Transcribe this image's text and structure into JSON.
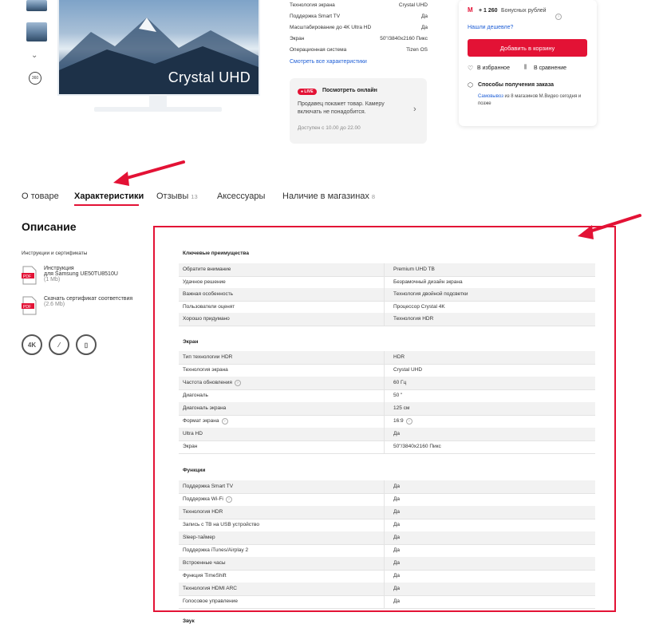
{
  "product": {
    "brand_text": "Crystal UHD"
  },
  "summary": {
    "rows": [
      {
        "label": "Технология экрана",
        "value": "Crystal UHD"
      },
      {
        "label": "Поддержка Smart TV",
        "value": "Да"
      },
      {
        "label": "Масштабирование до 4K Ultra HD",
        "value": "Да"
      },
      {
        "label": "Экран",
        "value": "50\"/3840x2160 Пикс"
      },
      {
        "label": "Операционная система",
        "value": "Tizen OS"
      }
    ],
    "all_specs_link": "Смотреть все характеристики"
  },
  "live": {
    "badge": "● LIVE",
    "title": "Посмотреть онлайн",
    "text": "Продавец покажет товар. Камеру включать не понадобится.",
    "hours": "Доступен с 10.00 до 22.00"
  },
  "buy": {
    "bonus": "+ 1 260",
    "bonus_text": "Бонусных рублей",
    "cheaper_link": "Нашли дешевле?",
    "cart_button": "Добавить в корзину",
    "wishlist": "В избранное",
    "compare": "В сравнение",
    "delivery_title": "Способы получения заказа",
    "pickup_link": "Самовывоз",
    "pickup_text": " из 8 магазинов М.Видео сегодня и позже"
  },
  "tabs": [
    {
      "label": "О товаре",
      "count": ""
    },
    {
      "label": "Характеристики",
      "count": ""
    },
    {
      "label": "Отзывы",
      "count": "13"
    },
    {
      "label": "Аксессуары",
      "count": ""
    },
    {
      "label": "Наличие в магазинах",
      "count": "8"
    }
  ],
  "description": {
    "title": "Описание",
    "docs_title": "Инструкции и сертификаты",
    "docs": [
      {
        "name": "Инструкция",
        "name2": "для Samsung UE50TU8510U",
        "size": "(1 Mb)"
      },
      {
        "name": "Скачать сертификат соответствия",
        "name2": "",
        "size": "(2.6 Mb)"
      }
    ],
    "badge_4k": "4K"
  },
  "specs": {
    "groups": [
      {
        "title": "Ключевые преимущества",
        "rows": [
          {
            "k": "Обратите внимание",
            "v": "Premium UHD TB"
          },
          {
            "k": "Удачное решение",
            "v": "Безрамочный дизайн экрана"
          },
          {
            "k": "Важная особенность",
            "v": "Технология двойной подсветки"
          },
          {
            "k": "Пользователи оценят",
            "v": "Процессор Crystal 4K"
          },
          {
            "k": "Хорошо придумано",
            "v": "Технология HDR"
          }
        ]
      },
      {
        "title": "Экран",
        "rows": [
          {
            "k": "Тип технологии HDR",
            "v": "HDR"
          },
          {
            "k": "Технология экрана",
            "v": "Crystal UHD"
          },
          {
            "k": "Частота обновления",
            "v": "60 Гц",
            "info": true
          },
          {
            "k": "Диагональ",
            "v": "50 \""
          },
          {
            "k": "Диагональ экрана",
            "v": "125 см"
          },
          {
            "k": "Формат экрана",
            "v": "16:9",
            "info": true,
            "vinfo": true
          },
          {
            "k": "Ultra HD",
            "v": "Да"
          },
          {
            "k": "Экран",
            "v": "50\"/3840x2160 Пикс"
          }
        ]
      },
      {
        "title": "Функции",
        "rows": [
          {
            "k": "Поддержка Smart TV",
            "v": "Да"
          },
          {
            "k": "Поддержка Wi-Fi",
            "v": "Да",
            "info": true
          },
          {
            "k": "Технология HDR",
            "v": "Да"
          },
          {
            "k": "Запись с ТВ на USB устройство",
            "v": "Да"
          },
          {
            "k": "Sleep-таймер",
            "v": "Да"
          },
          {
            "k": "Поддержка iTunes/Airplay 2",
            "v": "Да"
          },
          {
            "k": "Встроенные часы",
            "v": "Да"
          },
          {
            "k": "Функция TimeShift",
            "v": "Да"
          },
          {
            "k": "Технология HDMI ARC",
            "v": "Да"
          },
          {
            "k": "Голосовое управление",
            "v": "Да"
          }
        ]
      }
    ],
    "next_group_partial": "Звук"
  },
  "colors": {
    "accent": "#e31235",
    "link": "#1f5fd6"
  }
}
